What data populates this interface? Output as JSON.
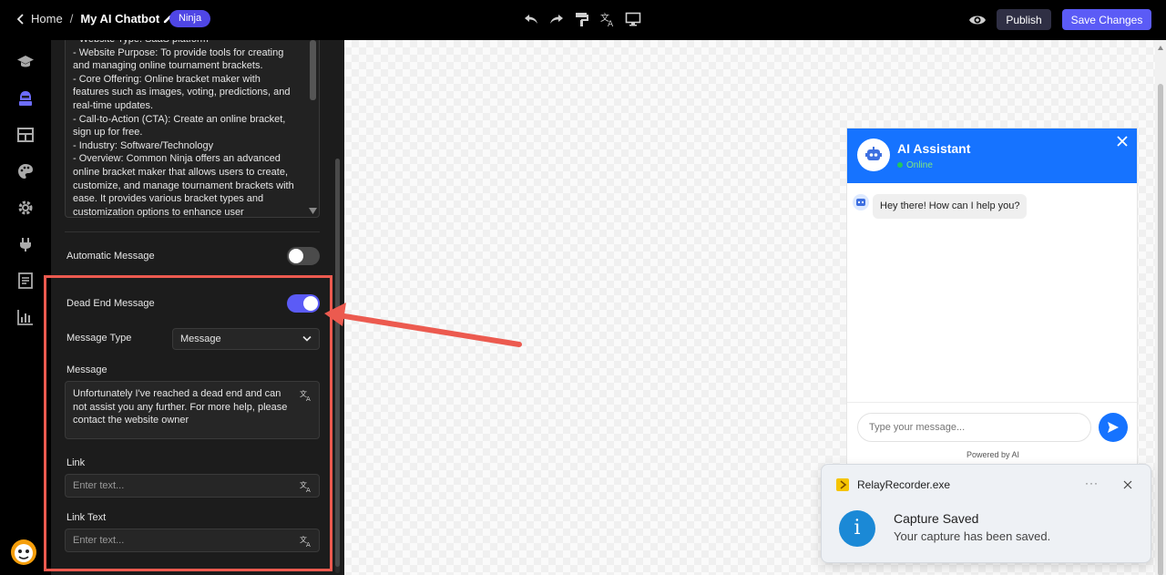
{
  "topbar": {
    "home_label": "Home",
    "separator": "/",
    "widget_title": "My AI Chatbot",
    "badge": "Ninja",
    "publish_label": "Publish",
    "save_label": "Save Changes"
  },
  "rail": {
    "icons": [
      "graduation-cap-icon",
      "ninja-icon",
      "layout-icon",
      "palette-icon",
      "settings-icon",
      "plug-icon",
      "form-icon",
      "analytics-icon"
    ]
  },
  "panel": {
    "description_text": "- Website Type: SaaS platform\n- Website Purpose: To provide tools for creating and managing online tournament brackets.\n- Core Offering: Online bracket maker with features such as images, voting, predictions, and real-time updates.\n- Call-to-Action (CTA): Create an online bracket, sign up for free.\n- Industry: Software/Technology\n- Overview: Common Ninja offers an advanced online bracket maker that allows users to create, customize, and manage tournament brackets with ease. It provides various bracket types and customization options to enhance user",
    "automatic_message_label": "Automatic Message",
    "automatic_message_on": false,
    "dead_end_label": "Dead End Message",
    "dead_end_on": true,
    "message_type_label": "Message Type",
    "message_type_value": "Message",
    "message_label": "Message",
    "message_value": "Unfortunately I've reached a dead end and can not assist you any further. For more help, please contact the website owner",
    "link_label": "Link",
    "link_placeholder": "Enter text...",
    "link_text_label": "Link Text",
    "link_text_placeholder": "Enter text..."
  },
  "chat": {
    "title": "AI Assistant",
    "status": "Online",
    "greeting": "Hey there! How can I help you?",
    "input_placeholder": "Type your message...",
    "powered_by": "Powered by AI",
    "header_color": "#1673ff"
  },
  "toast": {
    "app_name": "RelayRecorder.exe",
    "more": "···",
    "title": "Capture Saved",
    "body": "Your capture has been saved.",
    "info_glyph": "i"
  },
  "colors": {
    "accent": "#5b5bf6",
    "highlight": "#ec5a4f"
  }
}
